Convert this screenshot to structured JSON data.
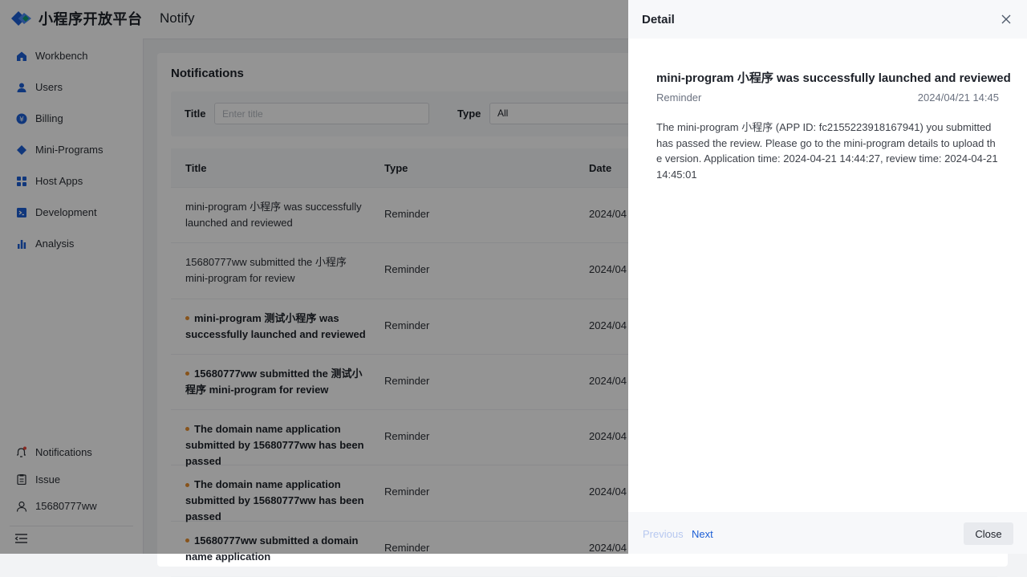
{
  "sidebar": {
    "logo_text": "小程序开放平台",
    "items": [
      {
        "label": "Workbench",
        "icon": "home-icon"
      },
      {
        "label": "Users",
        "icon": "user-icon"
      },
      {
        "label": "Billing",
        "icon": "billing-icon"
      },
      {
        "label": "Mini-Programs",
        "icon": "diamond-icon"
      },
      {
        "label": "Host Apps",
        "icon": "grid-icon"
      },
      {
        "label": "Development",
        "icon": "terminal-icon"
      },
      {
        "label": "Analysis",
        "icon": "bar-chart-icon"
      }
    ],
    "bottom_items": [
      {
        "label": "Notifications",
        "icon": "bell-icon"
      },
      {
        "label": "Issue",
        "icon": "clipboard-icon"
      },
      {
        "label": "15680777ww",
        "icon": "person-icon"
      }
    ]
  },
  "header": {
    "title": "Notify"
  },
  "main": {
    "card_title": "Notifications",
    "filters": {
      "title_label": "Title",
      "title_placeholder": "Enter title",
      "type_label": "Type",
      "type_value": "All"
    },
    "table": {
      "columns": [
        "Title",
        "Type",
        "Date"
      ],
      "rows": [
        {
          "title": "mini-program 小程序 was successfully launched and reviewed",
          "type": "Reminder",
          "date": "2024/04",
          "unread": false
        },
        {
          "title": "15680777ww submitted the 小程序 mini-program for review",
          "type": "Reminder",
          "date": "2024/04",
          "unread": false
        },
        {
          "title": "mini-program 测试小程序 was successfully launched and reviewed",
          "type": "Reminder",
          "date": "2024/04",
          "unread": true
        },
        {
          "title": "15680777ww submitted the 测试小程序 mini-program for review",
          "type": "Reminder",
          "date": "2024/04",
          "unread": true
        },
        {
          "title": "The domain name application submitted by 15680777ww has been passed",
          "type": "Reminder",
          "date": "2024/04",
          "unread": true
        },
        {
          "title": "The domain name application submitted by 15680777ww has been passed",
          "type": "Reminder",
          "date": "2024/04",
          "unread": true
        },
        {
          "title": "15680777ww submitted a domain name application",
          "type": "Reminder",
          "date": "2024/04",
          "unread": true
        }
      ]
    }
  },
  "drawer": {
    "title": "Detail",
    "notice_title": "mini-program 小程序 was successfully launched and reviewed",
    "notice_type": "Reminder",
    "notice_time": "2024/04/21 14:45",
    "notice_body": "The mini-program 小程序 (APP ID: fc2155223918167941) you submitted has passed the review. Please go to the mini-program details to upload the version. Application time: 2024-04-21 14:44:27, review time: 2024-04-21 14:45:01",
    "prev_label": "Previous",
    "next_label": "Next",
    "close_label": "Close"
  },
  "colors": {
    "accent": "#1d5fd6",
    "unread_dot": "#e8902f",
    "overlay": "rgba(0,0,0,0.42)"
  }
}
